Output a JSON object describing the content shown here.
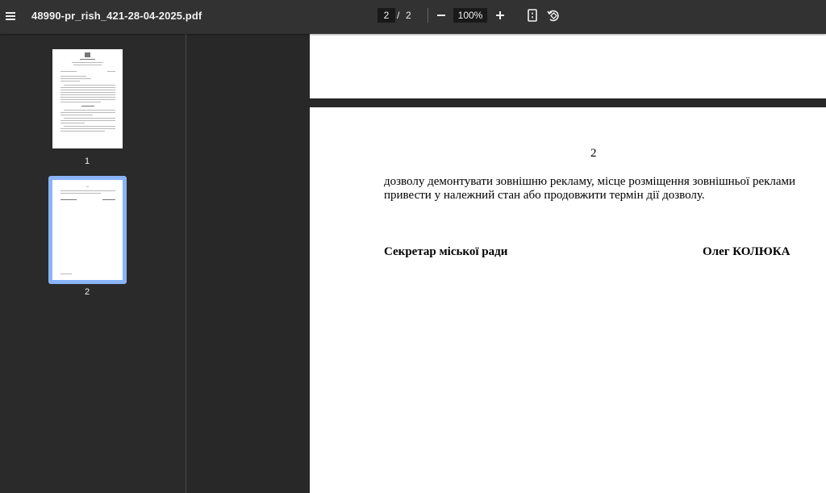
{
  "toolbar": {
    "title": "48990-pr_rish_421-28-04-2025.pdf",
    "current_page": "2",
    "page_separator": "/",
    "total_pages": "2",
    "zoom": "100%",
    "icons": {
      "menu": "menu-icon",
      "zoom_out": "minus-icon",
      "zoom_in": "plus-icon",
      "fit": "fit-to-page-icon",
      "rotate": "rotate-icon"
    }
  },
  "sidebar": {
    "thumbnails": [
      {
        "label": "1",
        "selected": false
      },
      {
        "label": "2",
        "selected": true
      }
    ],
    "selected_color": "#8ab4f8"
  },
  "document": {
    "page_number": "2",
    "paragraph_lines": [
      "дозволу  демонтувати зовнішню рекламу, місце розміщення зовнішньої реклами",
      "привести у належний стан або продовжити термін дії дозволу."
    ],
    "signature_title": "Секретар міської ради",
    "signature_name": "Олег КОЛЮКА"
  }
}
